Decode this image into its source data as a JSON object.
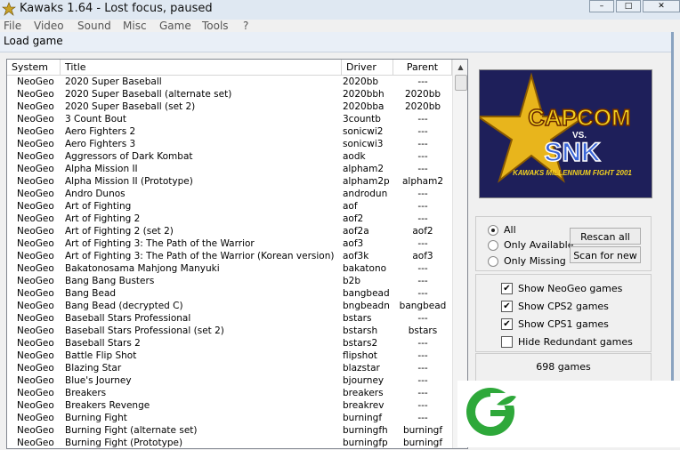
{
  "app": {
    "title": "Kawaks 1.64 - Lost focus, paused",
    "menu": [
      "File",
      "Video",
      "Sound",
      "Misc",
      "Game",
      "Tools",
      "?"
    ]
  },
  "dialog": {
    "title": "Load game",
    "columns": [
      "System",
      "Title",
      "Driver",
      "Parent"
    ],
    "rows": [
      [
        "NeoGeo",
        "2020 Super Baseball",
        "2020bb",
        "---"
      ],
      [
        "NeoGeo",
        "2020 Super Baseball (alternate set)",
        "2020bbh",
        "2020bb"
      ],
      [
        "NeoGeo",
        "2020 Super Baseball (set 2)",
        "2020bba",
        "2020bb"
      ],
      [
        "NeoGeo",
        "3 Count Bout",
        "3countb",
        "---"
      ],
      [
        "NeoGeo",
        "Aero Fighters 2",
        "sonicwi2",
        "---"
      ],
      [
        "NeoGeo",
        "Aero Fighters 3",
        "sonicwi3",
        "---"
      ],
      [
        "NeoGeo",
        "Aggressors of Dark Kombat",
        "aodk",
        "---"
      ],
      [
        "NeoGeo",
        "Alpha Mission II",
        "alpham2",
        "---"
      ],
      [
        "NeoGeo",
        "Alpha Mission II (Prototype)",
        "alpham2p",
        "alpham2"
      ],
      [
        "NeoGeo",
        "Andro Dunos",
        "androdun",
        "---"
      ],
      [
        "NeoGeo",
        "Art of Fighting",
        "aof",
        "---"
      ],
      [
        "NeoGeo",
        "Art of Fighting 2",
        "aof2",
        "---"
      ],
      [
        "NeoGeo",
        "Art of Fighting 2 (set 2)",
        "aof2a",
        "aof2"
      ],
      [
        "NeoGeo",
        "Art of Fighting 3: The Path of the Warrior",
        "aof3",
        "---"
      ],
      [
        "NeoGeo",
        "Art of Fighting 3: The Path of the Warrior (Korean version)",
        "aof3k",
        "aof3"
      ],
      [
        "NeoGeo",
        "Bakatonosama Mahjong Manyuki",
        "bakatono",
        "---"
      ],
      [
        "NeoGeo",
        "Bang Bang Busters",
        "b2b",
        "---"
      ],
      [
        "NeoGeo",
        "Bang Bead",
        "bangbead",
        "---"
      ],
      [
        "NeoGeo",
        "Bang Bead (decrypted C)",
        "bngbeadn",
        "bangbead"
      ],
      [
        "NeoGeo",
        "Baseball Stars Professional",
        "bstars",
        "---"
      ],
      [
        "NeoGeo",
        "Baseball Stars Professional (set 2)",
        "bstarsh",
        "bstars"
      ],
      [
        "NeoGeo",
        "Baseball Stars 2",
        "bstars2",
        "---"
      ],
      [
        "NeoGeo",
        "Battle Flip Shot",
        "flipshot",
        "---"
      ],
      [
        "NeoGeo",
        "Blazing Star",
        "blazstar",
        "---"
      ],
      [
        "NeoGeo",
        "Blue's Journey",
        "bjourney",
        "---"
      ],
      [
        "NeoGeo",
        "Breakers",
        "breakers",
        "---"
      ],
      [
        "NeoGeo",
        "Breakers Revenge",
        "breakrev",
        "---"
      ],
      [
        "NeoGeo",
        "Burning Fight",
        "burningf",
        "---"
      ],
      [
        "NeoGeo",
        "Burning Fight (alternate set)",
        "burningfh",
        "burningf"
      ],
      [
        "NeoGeo",
        "Burning Fight (Prototype)",
        "burningfp",
        "burningf"
      ]
    ],
    "preview": {
      "logo_top": "CAPCOM",
      "logo_vs": "VS.",
      "logo_bottom": "SNK",
      "subtitle": "KAWAKS MILLENNIUM FIGHT 2001"
    },
    "filter": {
      "options": [
        "All",
        "Only Available",
        "Only Missing"
      ],
      "selected": 0
    },
    "buttons": {
      "rescan": "Rescan all",
      "scan_new": "Scan for new"
    },
    "checkboxes": [
      {
        "label": "Show NeoGeo games",
        "checked": true
      },
      {
        "label": "Show CPS2 games",
        "checked": true
      },
      {
        "label": "Show CPS1 games",
        "checked": true
      },
      {
        "label": "Hide Redundant games",
        "checked": false
      }
    ],
    "game_count": "698 games"
  },
  "colors": {
    "accent_green": "#2ea83a",
    "preview_bg": "#1e1f5a",
    "logo_gold": "#e8b51c"
  }
}
